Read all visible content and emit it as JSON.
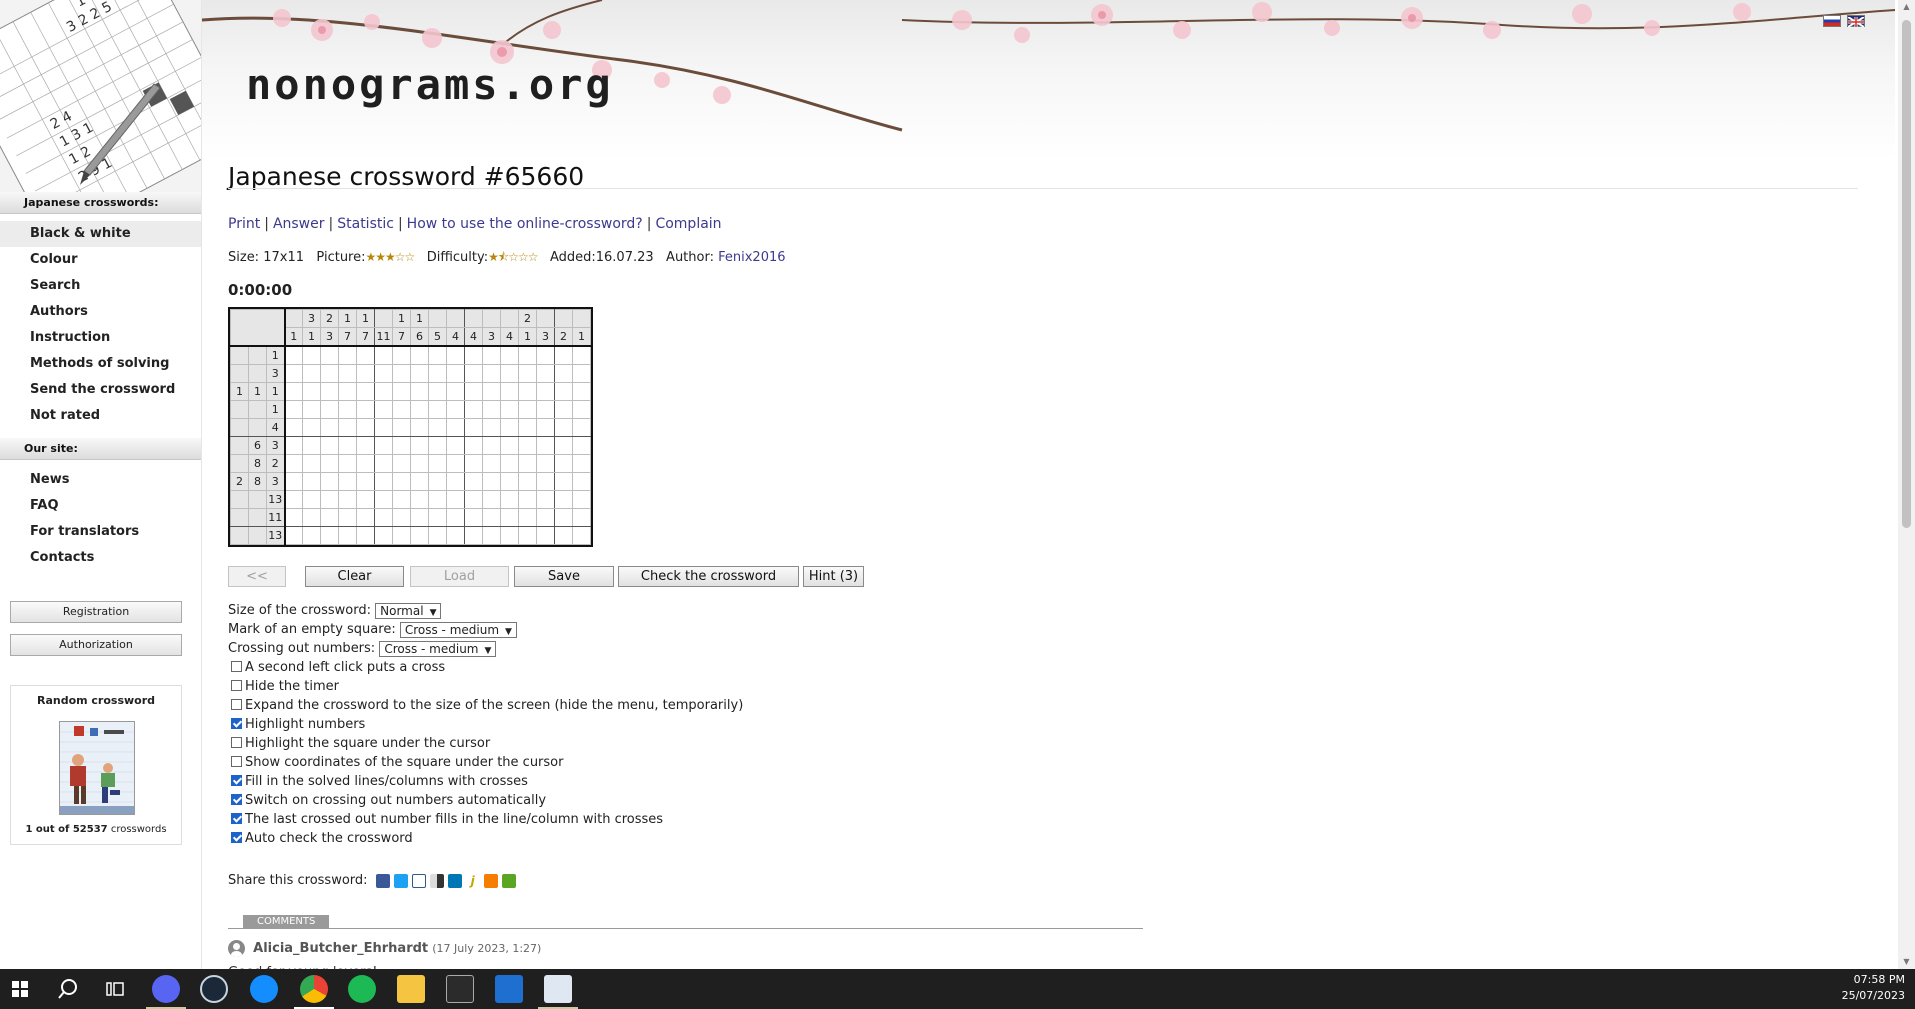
{
  "sidebar": {
    "section1_title": "Japanese crosswords:",
    "section1_items": [
      "Black & white",
      "Colour",
      "Search",
      "Authors",
      "Instruction",
      "Methods of solving",
      "Send the crossword",
      "Not rated"
    ],
    "section2_title": "Our site:",
    "section2_items": [
      "News",
      "FAQ",
      "For translators",
      "Contacts"
    ],
    "registration_label": "Registration",
    "authorization_label": "Authorization",
    "random": {
      "title": "Random crossword",
      "count_prefix": "1 out of 52537",
      "count_suffix": "crosswords"
    }
  },
  "header": {
    "site_name": "nonograms.org"
  },
  "page": {
    "title": "Japanese crossword #65660",
    "links": [
      "Print",
      "Answer",
      "Statistic",
      "How to use the online-crossword?",
      "Complain"
    ],
    "info": {
      "size_label": "Size:",
      "size_value": "17x11",
      "picture_label": "Picture:",
      "picture_rating": 3,
      "difficulty_label": "Difficulty:",
      "difficulty_rating": 1.5,
      "added_label": "Added:",
      "added_value": "16.07.23",
      "author_label": "Author:",
      "author_value": "Fenix2016"
    },
    "timer": "0:00:00"
  },
  "puzzle": {
    "cols": 17,
    "rows": 11,
    "col_clues": [
      [
        "",
        "1"
      ],
      [
        "3",
        "1"
      ],
      [
        "2",
        "3"
      ],
      [
        "1",
        "7"
      ],
      [
        "1",
        "7"
      ],
      [
        "",
        "11"
      ],
      [
        "1",
        "7"
      ],
      [
        "1",
        "6"
      ],
      [
        "",
        "5"
      ],
      [
        "",
        "4"
      ],
      [
        "",
        "4"
      ],
      [
        "",
        "3"
      ],
      [
        "",
        "4"
      ],
      [
        "2",
        "1"
      ],
      [
        "",
        "3"
      ],
      [
        "",
        "2"
      ],
      [
        "",
        "1"
      ]
    ],
    "row_clues": [
      [
        "",
        "",
        "1"
      ],
      [
        "",
        "",
        "3"
      ],
      [
        "1",
        "1",
        "1"
      ],
      [
        "",
        "",
        "1"
      ],
      [
        "",
        "",
        "4"
      ],
      [
        "",
        "6",
        "3"
      ],
      [
        "",
        "8",
        "2"
      ],
      [
        "2",
        "8",
        "3"
      ],
      [
        "",
        "",
        "13"
      ],
      [
        "",
        "",
        "11"
      ],
      [
        "",
        "",
        "13"
      ]
    ]
  },
  "buttons": {
    "back": "<<",
    "clear": "Clear",
    "load": "Load",
    "save": "Save",
    "check": "Check the crossword",
    "hint": "Hint (3)"
  },
  "settings": {
    "size_label": "Size of the crossword:",
    "size_value": "Normal",
    "empty_label": "Mark of an empty square:",
    "empty_value": "Cross - medium",
    "crossing_label": "Crossing out numbers:",
    "crossing_value": "Cross - medium",
    "checkboxes": [
      {
        "label": "A second left click puts a cross",
        "checked": false
      },
      {
        "label": "Hide the timer",
        "checked": false
      },
      {
        "label": "Expand the crossword to the size of the screen (hide the menu, temporarily)",
        "checked": false
      },
      {
        "label": "Highlight numbers",
        "checked": true
      },
      {
        "label": "Highlight the square under the cursor",
        "checked": false
      },
      {
        "label": "Show coordinates of the square under the cursor",
        "checked": false
      },
      {
        "label": "Fill in the solved lines/columns with crosses",
        "checked": true
      },
      {
        "label": "Switch on crossing out numbers automatically",
        "checked": true
      },
      {
        "label": "The last crossed out number fills in the line/column with crosses",
        "checked": true
      },
      {
        "label": "Auto check the crossword",
        "checked": true
      }
    ]
  },
  "share": {
    "label": "Share this crossword:",
    "icons": [
      "facebook-icon",
      "twitter-icon",
      "livejournal-icon",
      "delicious-icon",
      "linkedin-icon",
      "jabber-icon",
      "blogger-icon",
      "evernote-icon"
    ]
  },
  "comments": {
    "tab_label": "COMMENTS",
    "items": [
      {
        "user": "Alicia_Butcher_Ehrhardt",
        "date": "(17 July 2023, 1:27)",
        "text": "Good for young lovers!"
      }
    ]
  },
  "taskbar": {
    "time": "07:58 PM",
    "date": "25/07/2023",
    "apps": [
      "start-icon",
      "search-icon",
      "task-view-icon",
      "discord-icon",
      "steam-icon",
      "battlenet-icon",
      "chrome-icon",
      "spotify-icon",
      "file-explorer-icon",
      "terminal-icon",
      "photos-icon",
      "app-icon"
    ]
  },
  "colors": {
    "link": "#3b3a8f",
    "checkbox": "#1d63c9",
    "taskbar": "#1f1f1f"
  }
}
